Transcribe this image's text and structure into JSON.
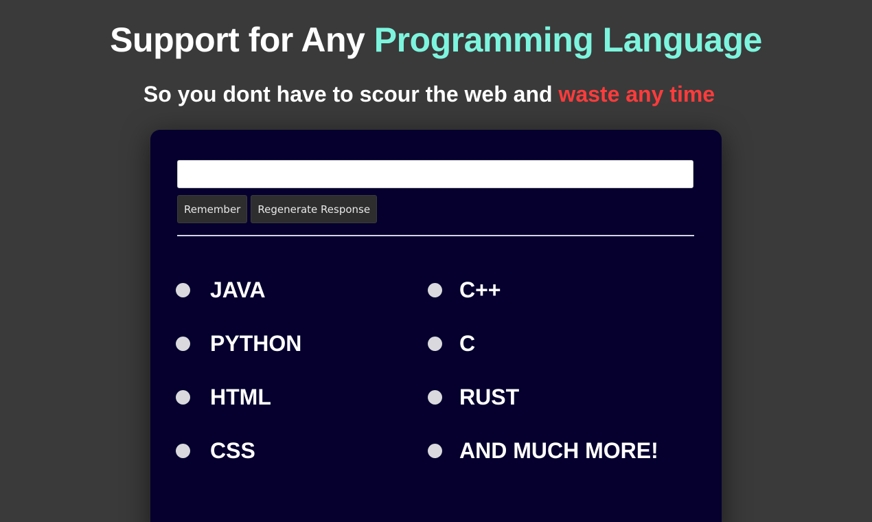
{
  "header": {
    "title_prefix": "Support for Any ",
    "title_highlight": "Programming Language",
    "subtitle_prefix": "So you dont have to scour the web and ",
    "subtitle_highlight": "waste any time"
  },
  "prompt": {
    "value": "",
    "placeholder": ""
  },
  "actions": {
    "remember_label": "Remember",
    "regenerate_label": "Regenerate Response"
  },
  "languages": [
    "JAVA",
    "C++",
    "PYTHON",
    "C",
    "HTML",
    "RUST",
    "CSS",
    "AND MUCH MORE!"
  ],
  "colors": {
    "background": "#3a3a3a",
    "panel": "#05002e",
    "title_accent": "#7df5de",
    "subtitle_accent": "#ff3b3b"
  }
}
